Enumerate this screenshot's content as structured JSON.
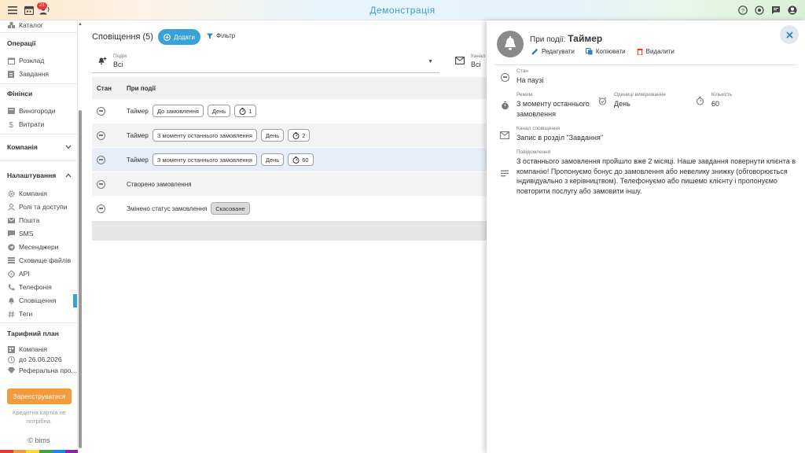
{
  "app": {
    "title": "Демонстрація",
    "badge_count": "21"
  },
  "sidebar": {
    "catalog": "Каталог",
    "sections": {
      "operations": "Операції",
      "finance": "Фінінси",
      "company": "Компанія",
      "settings": "Налаштування",
      "plan": "Тарифний план"
    },
    "operations_items": [
      "Розклад",
      "Завдання"
    ],
    "finance_items": [
      "Виногороди",
      "Витрати"
    ],
    "settings_items": [
      "Компанія",
      "Ролі та доступи",
      "Пошта",
      "SMS",
      "Месенджери",
      "Сховище файлів",
      "API",
      "Телефонія",
      "Сповіщення",
      "Теги"
    ],
    "plan_items": [
      "Компанія",
      "до 26.06.2026",
      "Реферальна про..."
    ],
    "register_button": "Зареєструватися",
    "card_note": "Кредитна картка не потрібна.",
    "brand": "© bims",
    "strip_colors": [
      "#e53935",
      "#f29a3c",
      "#fdd835",
      "#43a047",
      "#1e88e5",
      "#8e24aa"
    ]
  },
  "main": {
    "title": "Сповіщення (5)",
    "add_button": "Додати",
    "filter_button": "Фільтр",
    "event_filter": {
      "label": "Подія",
      "value": "Всі"
    },
    "channel_filter": {
      "label": "Канал",
      "value": "Всі"
    },
    "table": {
      "columns": [
        "Стан",
        "При події"
      ],
      "rows": [
        {
          "event": "Таймер",
          "mode": "До замовлення",
          "unit": "День",
          "count": "1",
          "selected": false
        },
        {
          "event": "Таймер",
          "mode": "З моменту останнього замовлення",
          "unit": "День",
          "count": "2",
          "selected": false
        },
        {
          "event": "Таймер",
          "mode": "З моменту останнього замовлення",
          "unit": "День",
          "count": "60",
          "selected": true
        },
        {
          "event": "Створено замовлення"
        },
        {
          "event": "Змінено статус замовлення",
          "status_chip": "Скасоване"
        }
      ]
    }
  },
  "panel": {
    "title_prefix": "При події:",
    "title": "Таймер",
    "actions": {
      "edit": "Редагувати",
      "copy": "Копіювати",
      "delete": "Видалити"
    },
    "state": {
      "label": "Стан",
      "value": "На паузі"
    },
    "mode": {
      "label": "Режим",
      "value": "З моменту останнього замовлення"
    },
    "unit": {
      "label": "Одиниці вимірювання",
      "value": "День"
    },
    "count": {
      "label": "Кількість",
      "value": "60"
    },
    "channel": {
      "label": "Канал сповіщення",
      "value": "Запис в розділ \"Завдання\""
    },
    "message": {
      "label": "Повідомлення",
      "value": "З останнього замовлення пройшло вже 2 місяці. Наше завдання повернути клієнта в компанію! Пропонуємо бонус до замовлення або невелику знижку (обговорюється індивідуально з керівництвом). Телефонуємо або пишемо клієнту і пропонуємо повторити послугу або замовити іншу."
    }
  }
}
